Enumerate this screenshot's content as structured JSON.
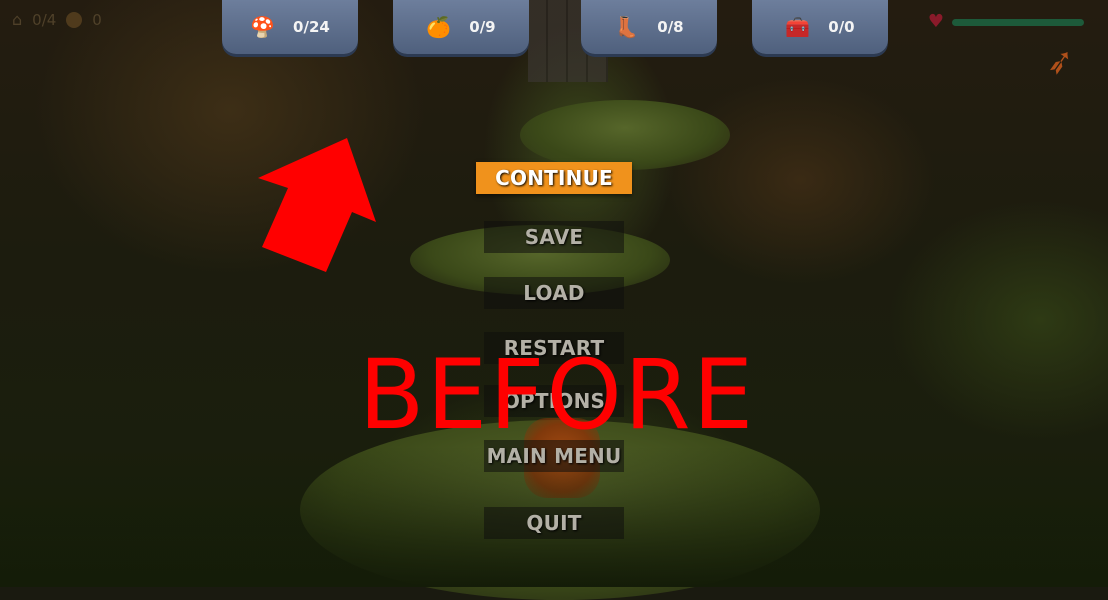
{
  "hud": {
    "lives_text": "0/4",
    "coins_text": "0",
    "counters": [
      {
        "icon": "mushroom-icon",
        "glyph": "🍄",
        "value": "0/24"
      },
      {
        "icon": "orange-fruit-icon",
        "glyph": "🍊",
        "value": "0/9"
      },
      {
        "icon": "boot-icon",
        "glyph": "👢",
        "value": "0/8"
      },
      {
        "icon": "treasure-chest-icon",
        "glyph": "🧰",
        "value": "0/0"
      }
    ],
    "health_fraction": 1.0,
    "colors": {
      "tab": "#5d6e8c",
      "health": "#1d5a3a",
      "heart": "#8a1a2a",
      "weapon": "#b0501a"
    }
  },
  "menu": {
    "items": [
      {
        "label": "CONTINUE",
        "active": true
      },
      {
        "label": "SAVE",
        "active": false
      },
      {
        "label": "LOAD",
        "active": false
      },
      {
        "label": "RESTART",
        "active": false
      },
      {
        "label": "OPTIONS",
        "active": false
      },
      {
        "label": "MAIN MENU",
        "active": false
      },
      {
        "label": "QUIT",
        "active": false
      }
    ],
    "active_color": "#f0921c"
  },
  "overlay": {
    "label": "BEFORE",
    "color": "#ff0000"
  }
}
